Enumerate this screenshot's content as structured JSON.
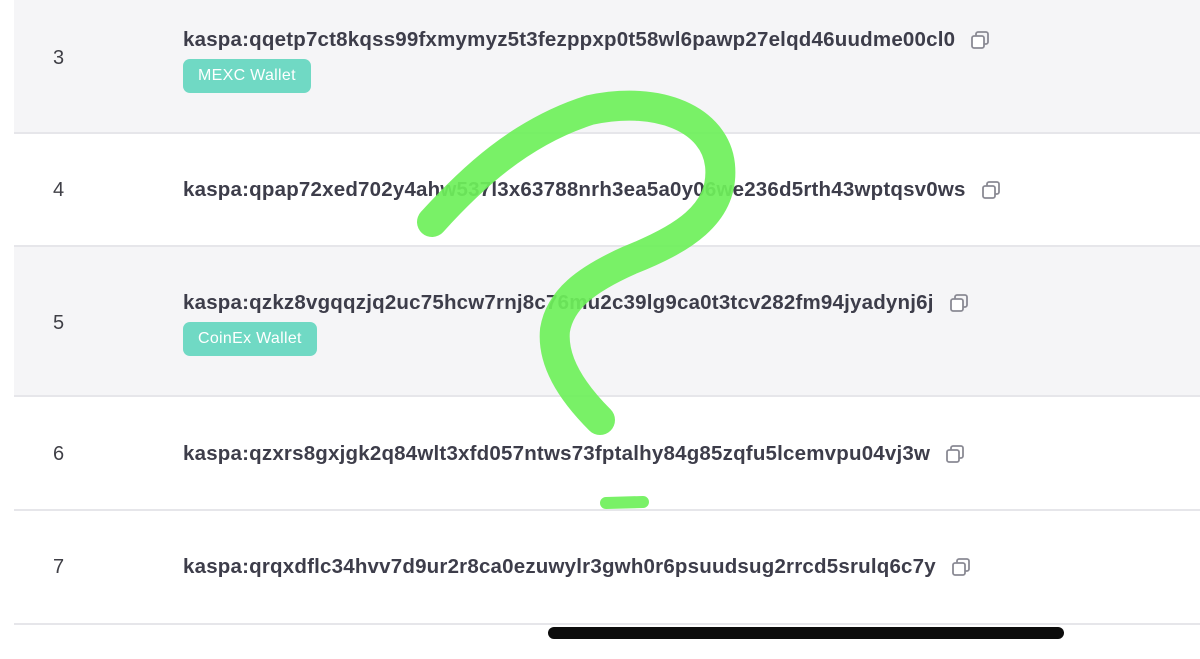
{
  "rows": [
    {
      "rank": "3",
      "address": "kaspa:qqetp7ct8kqss99fxmymyz5t3fezppxp0t58wl6pawp27elqd46uudme00cl0",
      "tag": "MEXC Wallet"
    },
    {
      "rank": "4",
      "address": "kaspa:qpap72xed702y4ahw537l3x63788nrh3ea5a0y06we236d5rth43wptqsv0ws"
    },
    {
      "rank": "5",
      "address": "kaspa:qzkz8vgqqzjq2uc75hcw7rnj8c76mu2c39lg9ca0t3tcv282fm94jyadynj6j",
      "tag": "CoinEx Wallet"
    },
    {
      "rank": "6",
      "address": "kaspa:qzxrs8gxjgk2q84wlt3xfd057ntws73fptalhy84g85zqfu5lcemvpu04vj3w"
    },
    {
      "rank": "7",
      "address": "kaspa:qrqxdflc34hvv7d9ur2r8ca0ezuwylr3gwh0r6psuudsug2rrcd5srulq6c7y"
    }
  ],
  "icons": {
    "copy": "copy-icon",
    "overlay": "question-mark-scribble"
  },
  "colors": {
    "tag_bg": "#70d9c4",
    "alt_row_bg": "#f5f5f7",
    "scribble": "#6ef05a"
  }
}
